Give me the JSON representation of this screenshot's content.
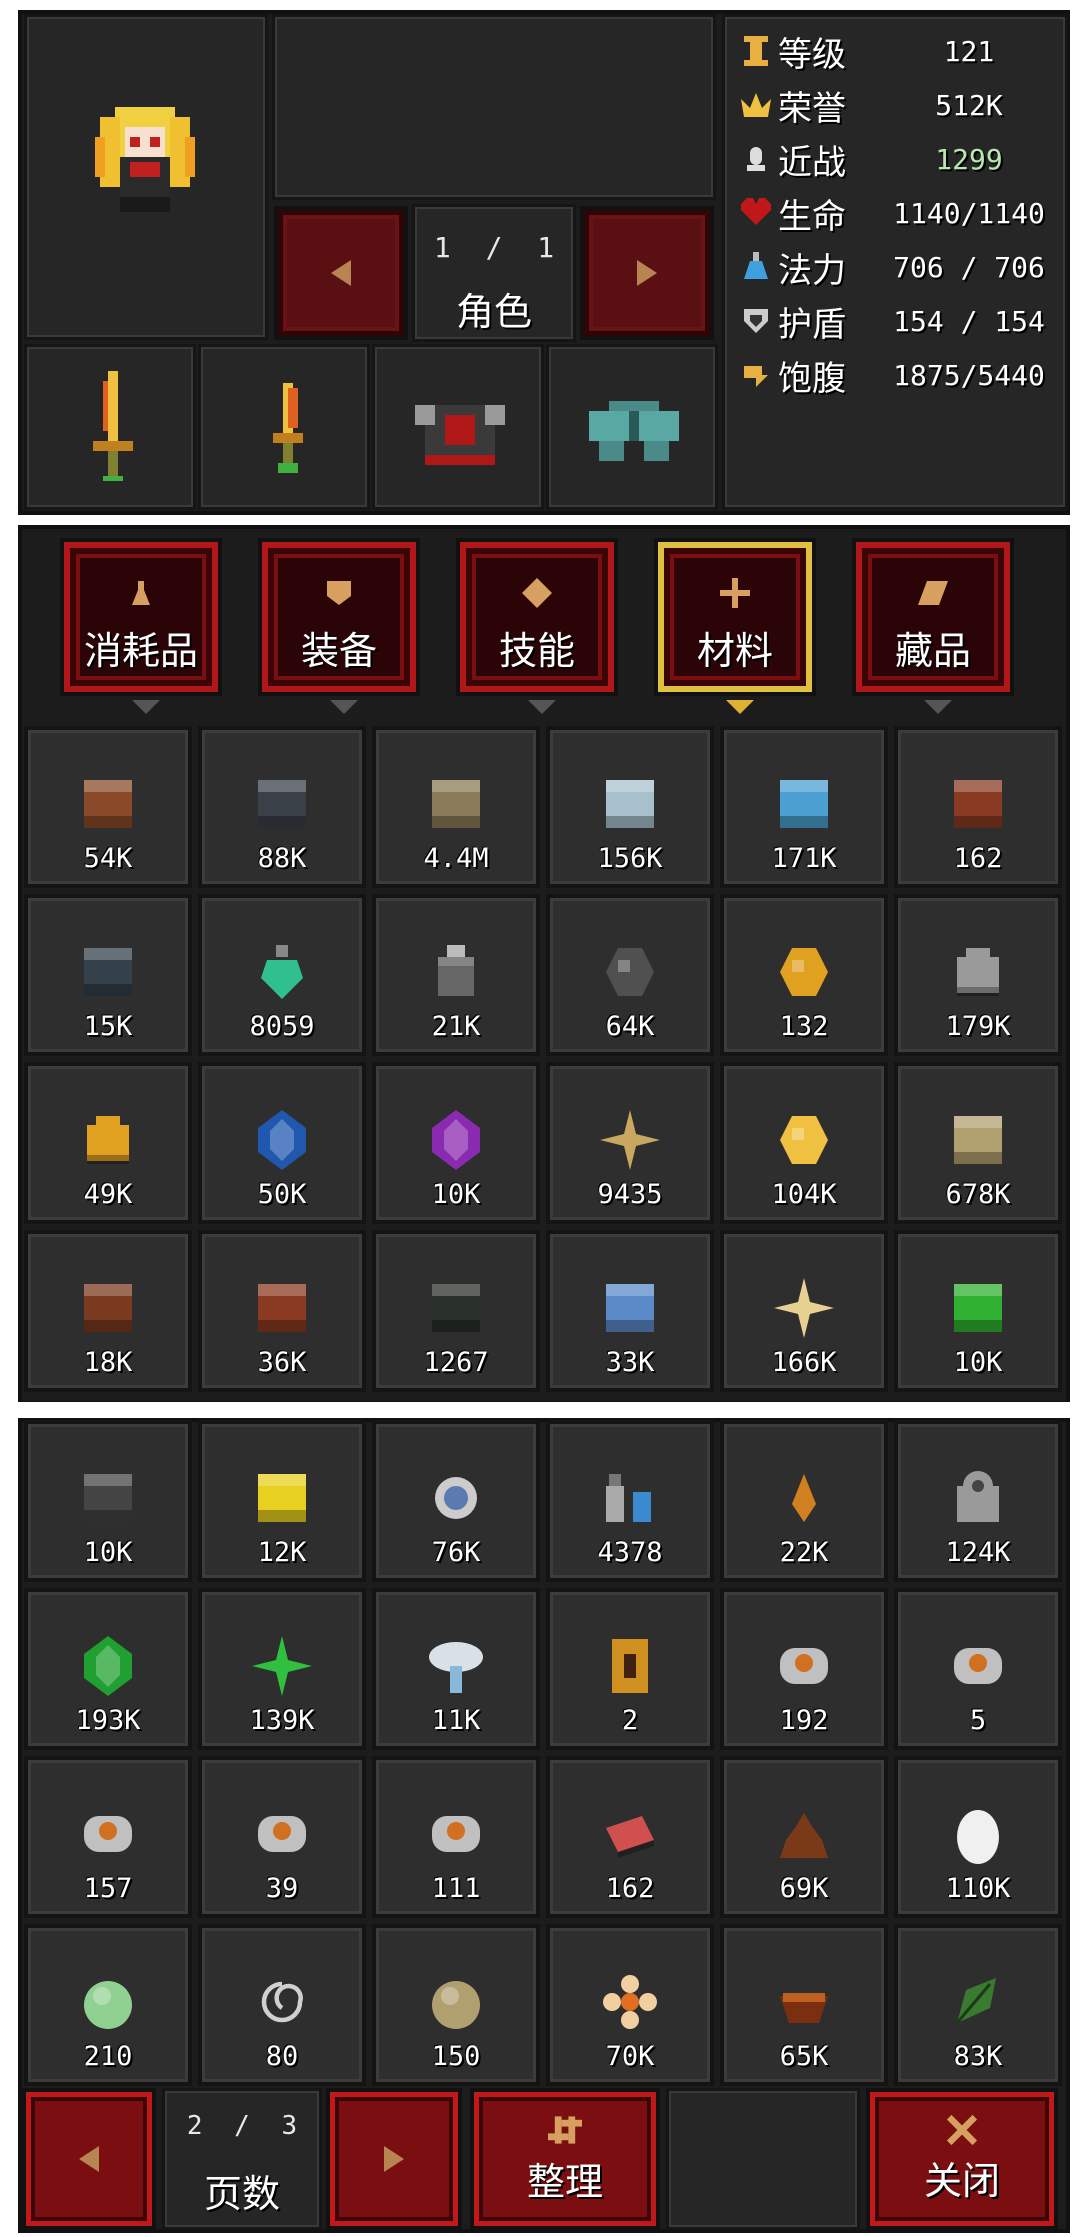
{
  "character": {
    "page_current": "1",
    "page_sep": "/",
    "page_total": "1",
    "label": "角色"
  },
  "stats": [
    {
      "icon": "level-icon",
      "name": "等级",
      "value": "121",
      "color": "#e8b040"
    },
    {
      "icon": "crown-icon",
      "name": "荣誉",
      "value": "512K",
      "color": "#f0c040"
    },
    {
      "icon": "melee-icon",
      "name": "近战",
      "value": "1299",
      "color": "#dddddd"
    },
    {
      "icon": "heart-icon",
      "name": "生命",
      "value": "1140/1140",
      "color": "#c01818"
    },
    {
      "icon": "potion-icon",
      "name": "法力",
      "value": "706 / 706",
      "color": "#3fa0e0"
    },
    {
      "icon": "shield-icon",
      "name": "护盾",
      "value": "154 / 154",
      "color": "#cccccc"
    },
    {
      "icon": "hunger-icon",
      "name": "饱腹",
      "value": "1875/5440",
      "color": "#e8b040"
    }
  ],
  "tabs": [
    {
      "label": "消耗品",
      "icon": "flask-icon",
      "active": false
    },
    {
      "label": "装备",
      "icon": "armor-icon",
      "active": false
    },
    {
      "label": "技能",
      "icon": "skill-icon",
      "active": false
    },
    {
      "label": "材料",
      "icon": "material-icon",
      "active": true
    },
    {
      "label": "藏品",
      "icon": "collection-icon",
      "active": false
    }
  ],
  "items_top": [
    {
      "icon": "brown-block-icon",
      "count": "54K",
      "color": "#8a4a2a"
    },
    {
      "icon": "dark-block-icon",
      "count": "88K",
      "color": "#3a4048"
    },
    {
      "icon": "sand-block-icon",
      "count": "4.4M",
      "color": "#8a7a58"
    },
    {
      "icon": "glass-block-icon",
      "count": "156K",
      "color": "#a8c0cc"
    },
    {
      "icon": "ice-block-icon",
      "count": "171K",
      "color": "#4aa0d0"
    },
    {
      "icon": "brick-block-icon",
      "count": "162",
      "color": "#8a3a22"
    },
    {
      "icon": "stone-brick-icon",
      "count": "15K",
      "color": "#34404a"
    },
    {
      "icon": "green-bottle-icon",
      "count": "8059",
      "color": "#30c090"
    },
    {
      "icon": "gray-jar-icon",
      "count": "21K",
      "color": "#666"
    },
    {
      "icon": "coal-ore-icon",
      "count": "64K",
      "color": "#505050"
    },
    {
      "icon": "gold-ore-icon",
      "count": "132",
      "color": "#e0a020"
    },
    {
      "icon": "iron-ingot-icon",
      "count": "179K",
      "color": "#9a9a9a"
    },
    {
      "icon": "gold-ingot-icon",
      "count": "49K",
      "color": "#e0a020"
    },
    {
      "icon": "sapphire-icon",
      "count": "50K",
      "color": "#2058b0"
    },
    {
      "icon": "amethyst-icon",
      "count": "10K",
      "color": "#8a2ab0"
    },
    {
      "icon": "crystal-cluster-icon",
      "count": "9435",
      "color": "#c8a860"
    },
    {
      "icon": "gold-nugget-icon",
      "count": "104K",
      "color": "#f0c040"
    },
    {
      "icon": "sandstone-icon",
      "count": "678K",
      "color": "#b0a070"
    },
    {
      "icon": "cracked-wood-icon",
      "count": "18K",
      "color": "#7a3a20"
    },
    {
      "icon": "wood-plank-icon",
      "count": "36K",
      "color": "#8a3a20"
    },
    {
      "icon": "obsidian-icon",
      "count": "1267",
      "color": "#2a302a"
    },
    {
      "icon": "blue-glass-icon",
      "count": "33K",
      "color": "#5a8ac8"
    },
    {
      "icon": "star-shard-icon",
      "count": "166K",
      "color": "#e8d090"
    },
    {
      "icon": "emerald-cube-icon",
      "count": "10K",
      "color": "#30b030"
    }
  ],
  "items_bottom": [
    {
      "icon": "dark-cube-icon",
      "count": "10K",
      "color": "#444"
    },
    {
      "icon": "gold-cube-icon",
      "count": "12K",
      "color": "#e8d020"
    },
    {
      "icon": "orb-icon",
      "count": "76K",
      "color": "#5a7ab0"
    },
    {
      "icon": "bottles-icon",
      "count": "4378",
      "color": "#3a8ad0"
    },
    {
      "icon": "amber-drop-icon",
      "count": "22K",
      "color": "#d08020"
    },
    {
      "icon": "machine-icon",
      "count": "124K",
      "color": "#9a9a9a"
    },
    {
      "icon": "emerald-icon",
      "count": "193K",
      "color": "#20a030"
    },
    {
      "icon": "green-crystal-icon",
      "count": "139K",
      "color": "#30c040"
    },
    {
      "icon": "mushroom-icon",
      "count": "11K",
      "color": "#d8e0e8"
    },
    {
      "icon": "golden-card-icon",
      "count": "2",
      "color": "#d09020"
    },
    {
      "icon": "button-orange-icon",
      "count": "192",
      "color": "#c0c0c0"
    },
    {
      "icon": "button-skull-icon",
      "count": "5",
      "color": "#c0c0c0"
    },
    {
      "icon": "button-swirl-icon",
      "count": "157",
      "color": "#c0c0c0"
    },
    {
      "icon": "button-tool-icon",
      "count": "39",
      "color": "#c0c0c0"
    },
    {
      "icon": "button-hook-icon",
      "count": "111",
      "color": "#c0c0c0"
    },
    {
      "icon": "raw-meat-icon",
      "count": "162",
      "color": "#d05050"
    },
    {
      "icon": "dung-icon",
      "count": "69K",
      "color": "#7a3a18"
    },
    {
      "icon": "egg-icon",
      "count": "110K",
      "color": "#f0f0f0"
    },
    {
      "icon": "cabbage-icon",
      "count": "210",
      "color": "#90d090"
    },
    {
      "icon": "string-icon",
      "count": "80",
      "color": "#d0d0d0"
    },
    {
      "icon": "onion-icon",
      "count": "150",
      "color": "#b0a070"
    },
    {
      "icon": "flower-icon",
      "count": "70K",
      "color": "#f0d0a0"
    },
    {
      "icon": "bowl-icon",
      "count": "65K",
      "color": "#7a3010"
    },
    {
      "icon": "leaf-icon",
      "count": "83K",
      "color": "#3a7a30"
    }
  ],
  "footer": {
    "page_current": "2",
    "page_sep": "/",
    "page_total": "3",
    "page_label": "页数",
    "sort_label": "整理",
    "close_label": "关闭"
  }
}
